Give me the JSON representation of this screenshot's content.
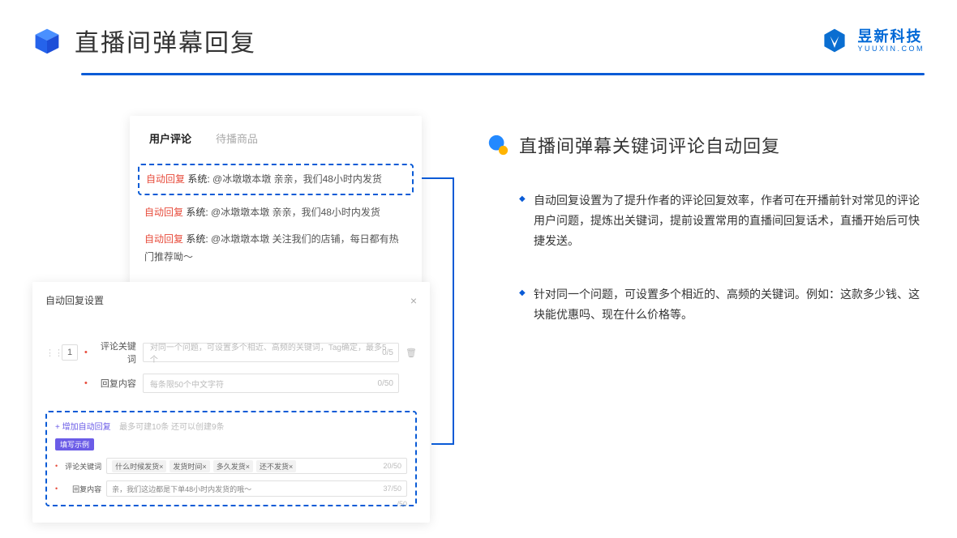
{
  "header": {
    "title": "直播间弹幕回复",
    "brand_cn": "昱新科技",
    "brand_en": "YUUXIN.COM"
  },
  "comments": {
    "tab_active": "用户评论",
    "tab_inactive": "待播商品",
    "items": [
      {
        "tag": "自动回复",
        "sys": "系统:",
        "text": "@冰墩墩本墩 亲亲，我们48小时内发货"
      },
      {
        "tag": "自动回复",
        "sys": "系统:",
        "text": "@冰墩墩本墩 亲亲，我们48小时内发货"
      },
      {
        "tag": "自动回复",
        "sys": "系统:",
        "text": "@冰墩墩本墩 关注我们的店铺，每日都有热门推荐呦～"
      }
    ]
  },
  "settings": {
    "title": "自动回复设置",
    "index": "1",
    "keyword_label": "评论关键词",
    "keyword_placeholder": "对同一个问题，可设置多个相近、高频的关键词，Tag确定，最多5个",
    "keyword_counter": "0/5",
    "content_label": "回复内容",
    "content_placeholder": "每条限50个中文字符",
    "content_counter": "0/50",
    "add_link": "+ 增加自动回复",
    "add_hint": "最多可建10条 还可以创建9条",
    "badge": "填写示例",
    "ex_kw_label": "评论关键词",
    "ex_tags": [
      "什么时候发货×",
      "发货时间×",
      "多久发货×",
      "还不发货×"
    ],
    "ex_kw_counter": "20/50",
    "ex_content_label": "回复内容",
    "ex_content_value": "亲，我们这边都是下单48小时内发货的哦～",
    "ex_content_counter": "37/50",
    "outer_counter": "/50"
  },
  "right": {
    "subtitle": "直播间弹幕关键词评论自动回复",
    "bullets": [
      "自动回复设置为了提升作者的评论回复效率，作者可在开播前针对常见的评论用户问题，提炼出关键词，提前设置常用的直播间回复话术，直播开始后可快捷发送。",
      "针对同一个问题，可设置多个相近的、高频的关键词。例如：这款多少钱、这块能优惠吗、现在什么价格等。"
    ]
  }
}
